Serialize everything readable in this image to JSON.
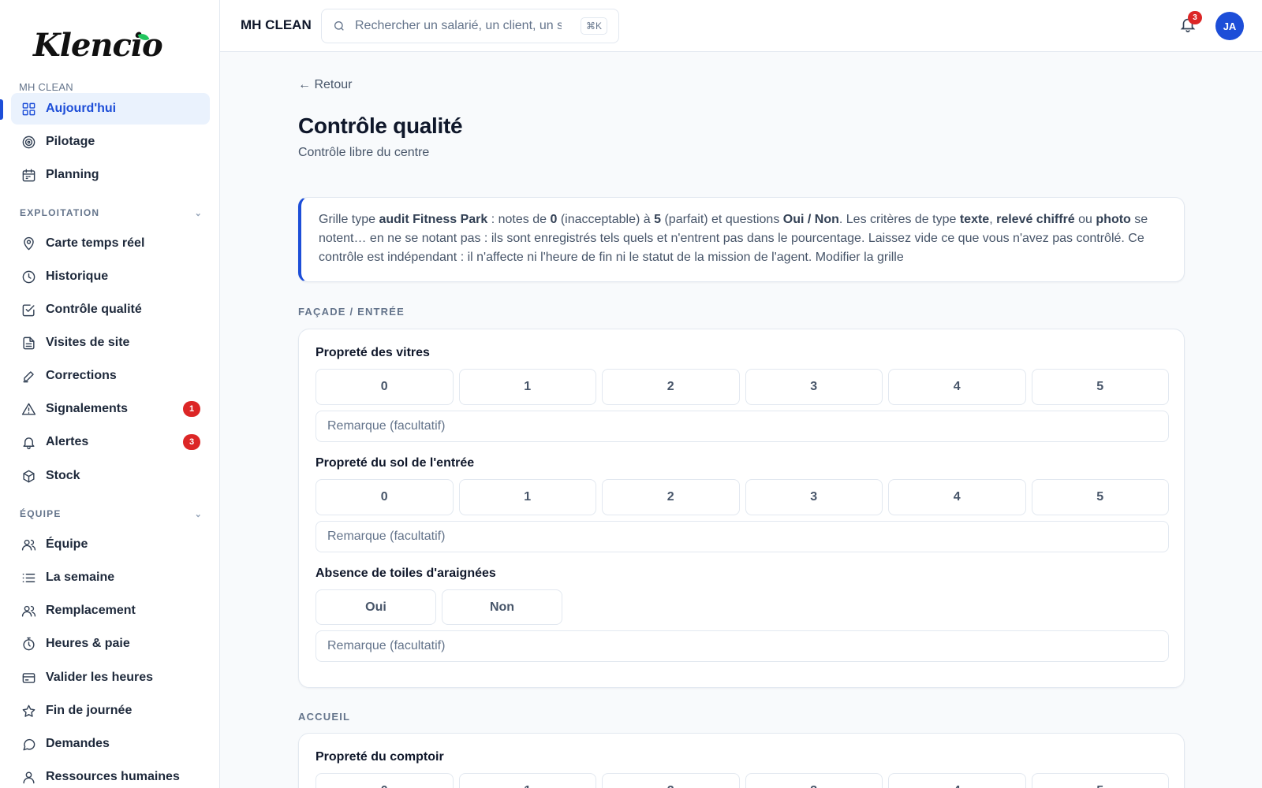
{
  "sidebar": {
    "logo": "Klencio",
    "org": "MH CLEAN",
    "items_top": [
      {
        "label": "Aujourd'hui",
        "icon": "grid-icon"
      },
      {
        "label": "Pilotage",
        "icon": "target-icon"
      },
      {
        "label": "Planning",
        "icon": "calendar-icon"
      }
    ],
    "section_exploitation": "EXPLOITATION",
    "items_exploitation": [
      {
        "label": "Carte temps réel",
        "icon": "map-pin-icon"
      },
      {
        "label": "Historique",
        "icon": "clock-icon"
      },
      {
        "label": "Contrôle qualité",
        "icon": "check-square-icon"
      },
      {
        "label": "Visites de site",
        "icon": "file-icon"
      },
      {
        "label": "Corrections",
        "icon": "pen-icon"
      },
      {
        "label": "Signalements",
        "icon": "warning-icon",
        "badge": "1"
      },
      {
        "label": "Alertes",
        "icon": "bell-icon",
        "badge": "3"
      },
      {
        "label": "Stock",
        "icon": "box-icon"
      }
    ],
    "section_equipe": "ÉQUIPE",
    "items_equipe": [
      {
        "label": "Équipe",
        "icon": "users-icon"
      },
      {
        "label": "La semaine",
        "icon": "list-icon"
      },
      {
        "label": "Remplacement",
        "icon": "users-icon"
      },
      {
        "label": "Heures & paie",
        "icon": "stopwatch-icon"
      },
      {
        "label": "Valider les heures",
        "icon": "card-icon"
      },
      {
        "label": "Fin de journée",
        "icon": "star-icon"
      },
      {
        "label": "Demandes",
        "icon": "chat-icon"
      },
      {
        "label": "Ressources humaines",
        "icon": "user-icon"
      }
    ]
  },
  "topbar": {
    "company": "MH CLEAN",
    "search_placeholder": "Rechercher un salarié, un client, un si",
    "shortcut": "⌘K",
    "notif_count": "3",
    "avatar": "JA"
  },
  "main": {
    "back": "← Retour",
    "title": "Contrôle qualité",
    "subtitle": "Contrôle libre du centre",
    "info": {
      "t1": "Grille type ",
      "b1": "audit Fitness Park",
      "t2": " : notes de ",
      "b2": "0",
      "t3": " (inacceptable) à ",
      "b3": "5",
      "t4": " (parfait) et questions ",
      "b4": "Oui / Non",
      "t5": ". Les critères de type ",
      "b5": "texte",
      "t6": ", ",
      "b6": "relevé chiffré",
      "t7": " ou ",
      "b7": "photo",
      "t8": " se notent… en ne se notant pas : ils sont enregistrés tels quels et n'entrent pas dans le pourcentage. Laissez vide ce que vous n'avez pas contrôlé. Ce contrôle est indépendant : il n'affecte ni l'heure de fin ni le statut de la mission de l'agent. Modifier la grille"
    },
    "section1": "FAÇADE / ENTRÉE",
    "q1": "Propreté des vitres",
    "q2": "Propreté du sol de l'entrée",
    "q3": "Absence de toiles d'araignées",
    "scores": [
      "0",
      "1",
      "2",
      "3",
      "4",
      "5"
    ],
    "yes": "Oui",
    "no": "Non",
    "remark_placeholder": "Remarque (facultatif)",
    "section2": "ACCUEIL",
    "q4": "Propreté du comptoir"
  }
}
